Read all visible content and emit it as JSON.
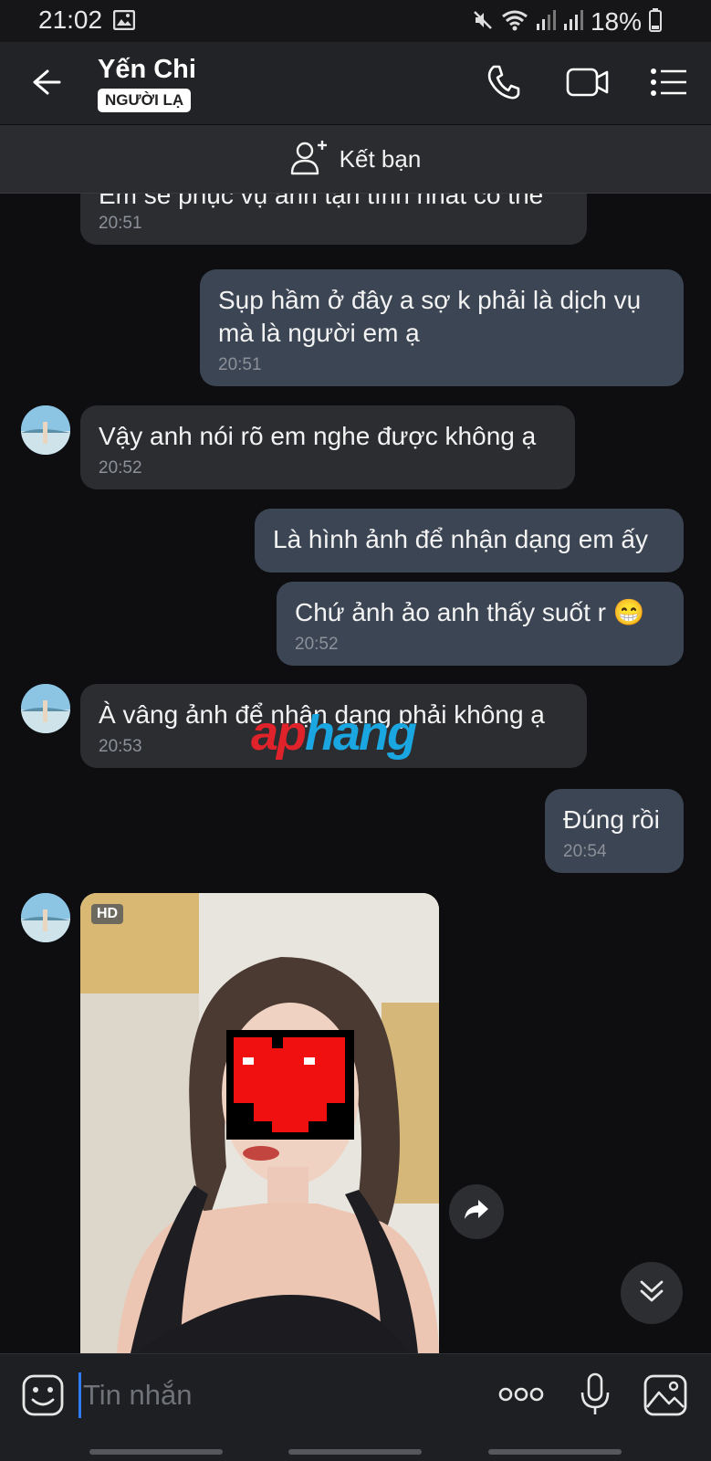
{
  "status_bar": {
    "time": "21:02",
    "battery": "18%"
  },
  "header": {
    "contact_name": "Yến Chi",
    "badge": "NGƯỜI LẠ"
  },
  "add_friend": {
    "label": "Kết bạn"
  },
  "messages": [
    {
      "dir": "in",
      "text": "Em sẽ phục vụ anh tận tình nhất có thể",
      "time": "20:51"
    },
    {
      "dir": "out",
      "text": "Sụp hầm ở đây a sợ k phải là dịch vụ mà là người em ạ",
      "time": "20:51"
    },
    {
      "dir": "in",
      "text": "Vậy anh nói rõ em nghe được không ạ",
      "time": "20:52"
    },
    {
      "dir": "out",
      "text": "Là hình ảnh để nhận dạng em ấy",
      "time": ""
    },
    {
      "dir": "out",
      "text": "Chứ ảnh ảo anh thấy suốt r 😁",
      "time": "20:52"
    },
    {
      "dir": "in",
      "text": "À vâng ảnh để nhận dạng phải không ạ",
      "time": "20:53"
    },
    {
      "dir": "out",
      "text": "Đúng rồi",
      "time": "20:54"
    }
  ],
  "photo": {
    "badge": "HD"
  },
  "watermark": {
    "part1": "ap",
    "part2": "hang",
    "color1": "#e0232a",
    "color2": "#1aa6e0"
  },
  "input": {
    "placeholder": "Tin nhắn"
  },
  "colors": {
    "accent": "#2f7bf5",
    "bubble_out": "#3c4553",
    "bubble_in": "#2c2d31"
  }
}
